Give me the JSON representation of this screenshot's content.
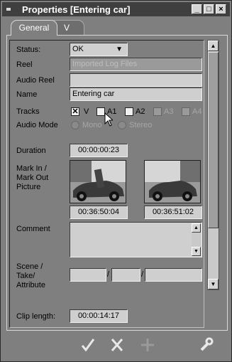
{
  "window": {
    "title": "Properties [Entering car]"
  },
  "window_buttons": {
    "minimize": "_",
    "maximize": "□",
    "close": "×"
  },
  "tabs": [
    {
      "label": "General",
      "active": true
    },
    {
      "label": "V",
      "active": false
    }
  ],
  "fields": {
    "status": {
      "label": "Status:",
      "value": "OK"
    },
    "reel": {
      "label": "Reel",
      "value": "Imported Log Files"
    },
    "audio_reel": {
      "label": "Audio Reel",
      "value": ""
    },
    "name": {
      "label": "Name",
      "value": "Entering car"
    },
    "tracks": {
      "label": "Tracks",
      "items": [
        {
          "label": "V",
          "checked": true,
          "enabled": true
        },
        {
          "label": "A1",
          "checked": false,
          "enabled": true
        },
        {
          "label": "A2",
          "checked": false,
          "enabled": true
        },
        {
          "label": "A3",
          "checked": false,
          "enabled": false
        },
        {
          "label": "A4",
          "checked": false,
          "enabled": false
        }
      ]
    },
    "audio_mode": {
      "label": "Audio Mode",
      "options": [
        "Mono",
        "Stereo"
      ]
    },
    "duration": {
      "label": "Duration",
      "value": "00:00:00:23"
    },
    "mark": {
      "label_line1": "Mark In /",
      "label_line2": "Mark Out",
      "label_line3": "Picture",
      "mark_in": "00:36:50:04",
      "mark_out": "00:36:51:02"
    },
    "comment": {
      "label": "Comment",
      "value": ""
    },
    "scene": {
      "label_line1": "Scene /",
      "label_line2": "Take/",
      "label_line3": "Attribute",
      "scene": "",
      "take": "",
      "attribute": "",
      "separator": "/"
    },
    "clip_length": {
      "label": "Clip length:",
      "value": "00:00:14:17"
    }
  },
  "toolbar": {
    "ok_icon": "check-icon",
    "cancel_icon": "x-icon",
    "add_icon": "plus-icon",
    "settings_icon": "wrench-icon"
  },
  "colors": {
    "window_bg": "#7f7f7f",
    "titlebar": "#3f3f3f",
    "field_bg": "#cfcfcf"
  }
}
